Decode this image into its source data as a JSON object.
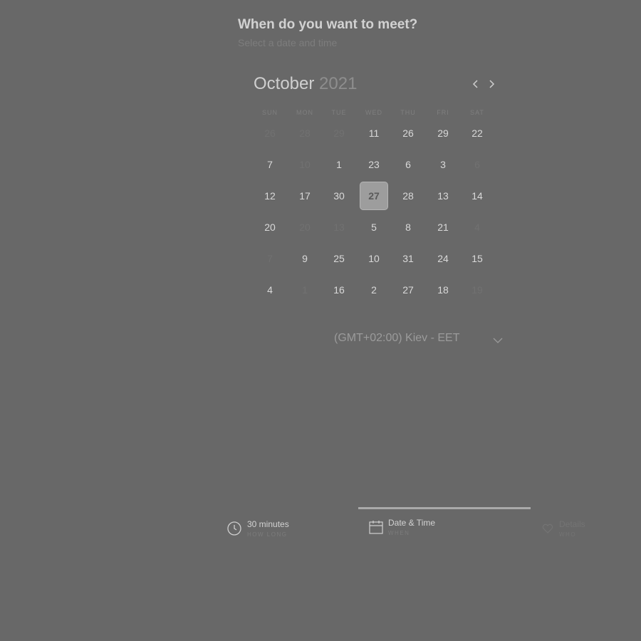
{
  "heading": {
    "title": "When do you want to meet?",
    "subtitle": "Select a date and time"
  },
  "calendar": {
    "month": "October",
    "year": "2021",
    "weekdays": [
      "SUN",
      "MON",
      "TUE",
      "WED",
      "THU",
      "FRI",
      "SAT"
    ],
    "weeks": [
      [
        "26",
        "28",
        "29",
        "11",
        "26",
        "29",
        "22"
      ],
      [
        "7",
        "10",
        "1",
        "23",
        "6",
        "3",
        "6"
      ],
      [
        "12",
        "17",
        "30",
        "27",
        "28",
        "13",
        "14"
      ],
      [
        "20",
        "20",
        "13",
        "5",
        "8",
        "21",
        "4"
      ],
      [
        "7",
        "9",
        "25",
        "10",
        "31",
        "24",
        "15"
      ],
      [
        "4",
        "1",
        "16",
        "2",
        "27",
        "18",
        "19"
      ]
    ],
    "dimmed": [
      [
        true,
        true,
        true,
        false,
        false,
        false,
        false
      ],
      [
        false,
        true,
        false,
        false,
        false,
        false,
        true
      ],
      [
        false,
        false,
        false,
        false,
        false,
        false,
        false
      ],
      [
        false,
        true,
        true,
        false,
        false,
        false,
        true
      ],
      [
        true,
        false,
        false,
        false,
        false,
        false,
        false
      ],
      [
        false,
        true,
        false,
        false,
        false,
        false,
        true
      ]
    ],
    "selected": "27"
  },
  "timezone": {
    "value": "(GMT+02:00) Kiev - EET"
  },
  "steps": [
    {
      "title": "30 minutes",
      "subtitle": "HOW LONG",
      "icon": "clock-icon"
    },
    {
      "title": "Date & Time",
      "subtitle": "WHEN",
      "icon": "calendar-icon"
    },
    {
      "title": "Details",
      "subtitle": "WHO",
      "icon": "heart-icon"
    }
  ],
  "colors": {
    "background": "#686868",
    "selected_day": "#9d9d9d",
    "active_bar": "#a9a9a9"
  }
}
